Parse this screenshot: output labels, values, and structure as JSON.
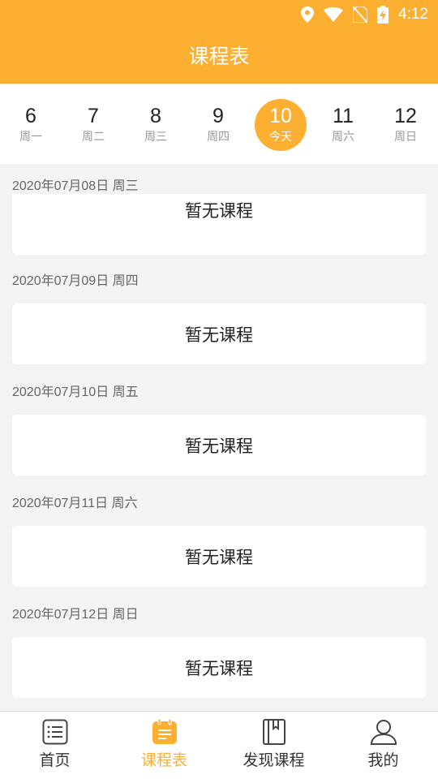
{
  "status_bar": {
    "time": "4:12"
  },
  "header": {
    "title": "课程表"
  },
  "week": {
    "days": [
      {
        "num": "6",
        "label": "周一"
      },
      {
        "num": "7",
        "label": "周二"
      },
      {
        "num": "8",
        "label": "周三"
      },
      {
        "num": "9",
        "label": "周四"
      },
      {
        "num": "10",
        "label": "今天"
      },
      {
        "num": "11",
        "label": "周六"
      },
      {
        "num": "12",
        "label": "周日"
      }
    ]
  },
  "schedule": [
    {
      "date": "2020年07月08日 周三",
      "text": "暂无课程"
    },
    {
      "date": "2020年07月09日 周四",
      "text": "暂无课程"
    },
    {
      "date": "2020年07月10日 周五",
      "text": "暂无课程"
    },
    {
      "date": "2020年07月11日 周六",
      "text": "暂无课程"
    },
    {
      "date": "2020年07月12日 周日",
      "text": "暂无课程"
    }
  ],
  "tabs": [
    {
      "label": "首页",
      "icon": "list-icon"
    },
    {
      "label": "课程表",
      "icon": "calendar-icon"
    },
    {
      "label": "发现课程",
      "icon": "book-icon"
    },
    {
      "label": "我的",
      "icon": "user-icon"
    }
  ],
  "colors": {
    "accent": "#fdaf32",
    "background": "#f4f4f4"
  }
}
